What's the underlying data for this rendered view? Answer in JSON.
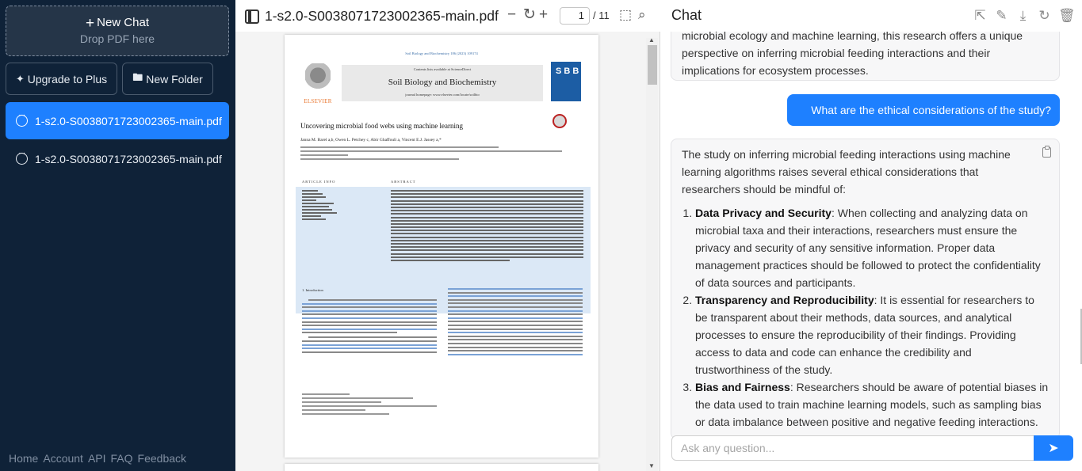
{
  "sidebar": {
    "new_chat": {
      "label": "New Chat",
      "sub": "Drop PDF here"
    },
    "upgrade_label": "Upgrade to Plus",
    "new_folder_label": "New Folder",
    "files": [
      {
        "name": "1-s2.0-S0038071723002365-main.pdf",
        "active": true
      },
      {
        "name": "1-s2.0-S0038071723002365-main.pdf",
        "active": false
      }
    ],
    "footer": [
      "Home",
      "Account",
      "API",
      "FAQ",
      "Feedback"
    ]
  },
  "pdf": {
    "title": "1-s2.0-S0038071723002365-main.pdf",
    "page_current": "1",
    "page_total": "/ 11",
    "page": {
      "journal_cite": "Soil Biology and Biochemistry 186 (2023) 109174",
      "contents_avail": "Contents lists available at ScienceDirect",
      "journal_name": "Soil Biology and Biochemistry",
      "homepage": "journal homepage: www.elsevier.com/locate/soilbio",
      "publisher": "ELSEVIER",
      "cover_text": "S B B",
      "article_title": "Uncovering microbial food webs using machine learning",
      "authors": "Janna M. Barel a,b, Owen L. Petchey c, Abir Ghaffouli a, Vincent E.J. Jassey a,*",
      "article_info_head": "ARTICLE INFO",
      "abstract_head": "ABSTRACT",
      "intro_head": "1. Introduction"
    }
  },
  "chat": {
    "title": "Chat",
    "prev_message": "microbial ecology and machine learning, this research offers a unique perspective on inferring microbial feeding interactions and their implications for ecosystem processes.",
    "user_message": "What are the ethical considerations of the study?",
    "ai_intro": "The study on inferring microbial feeding interactions using machine learning algorithms raises several ethical considerations that researchers should be mindful of:",
    "ai_points": [
      {
        "title": "Data Privacy and Security",
        "text": ": When collecting and analyzing data on microbial taxa and their interactions, researchers must ensure the privacy and security of any sensitive information. Proper data management practices should be followed to protect the confidentiality of data sources and participants."
      },
      {
        "title": "Transparency and Reproducibility",
        "text": ": It is essential for researchers to be transparent about their methods, data sources, and analytical processes to ensure the reproducibility of their findings. Providing access to data and code can enhance the credibility and trustworthiness of the study."
      },
      {
        "title": "Bias and Fairness",
        "text": ": Researchers should be aware of potential biases in the data used to train machine learning models, such as sampling bias or data imbalance between positive and negative feeding interactions. Ensuring fairness in model predictions and interpretations is crucial to"
      }
    ],
    "input_placeholder": "Ask any question...",
    "icons": [
      "export-icon",
      "edit-icon",
      "download-icon",
      "refresh-icon",
      "trash-icon"
    ]
  },
  "colors": {
    "sidebar_bg": "#0f2238",
    "accent": "#1e80ff"
  }
}
